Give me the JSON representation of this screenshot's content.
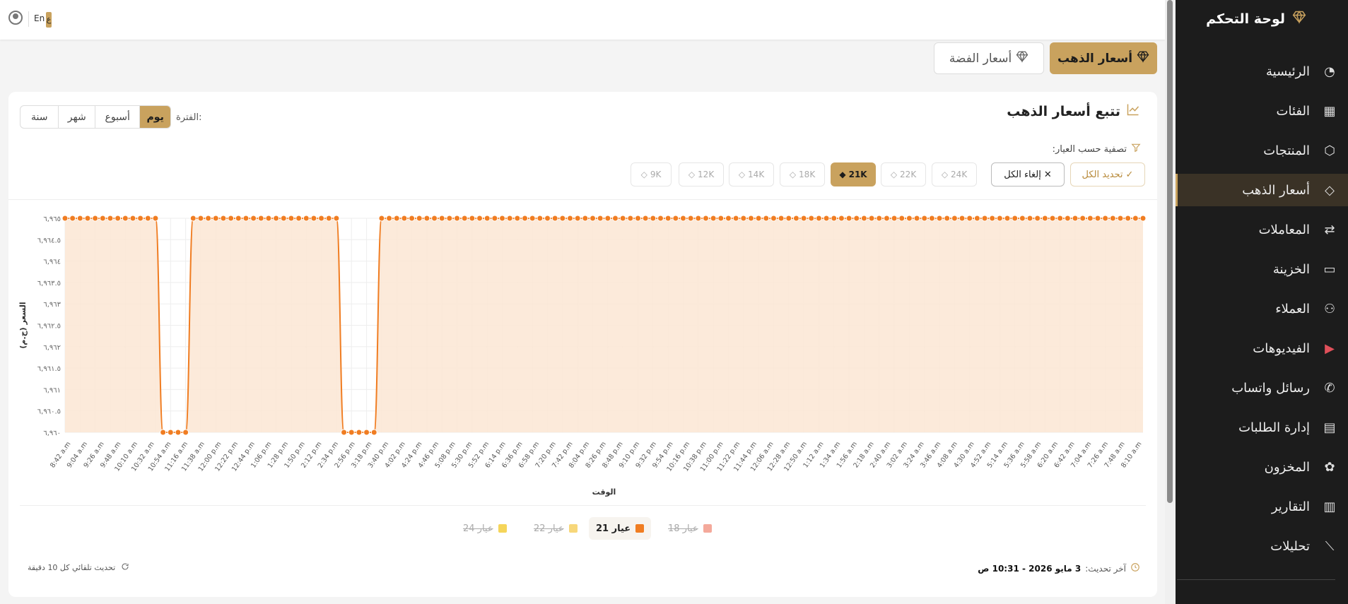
{
  "topbar": {
    "lang_en": "En",
    "lang_ar": "ع"
  },
  "sidebar": {
    "title": "لوحة التحكم",
    "items": [
      {
        "label": "الرئيسية",
        "icon": "gauge-icon"
      },
      {
        "label": "الفئات",
        "icon": "grid-icon"
      },
      {
        "label": "المنتجات",
        "icon": "box-icon"
      },
      {
        "label": "أسعار الذهب",
        "icon": "gem-icon",
        "active": true
      },
      {
        "label": "المعاملات",
        "icon": "transfer-icon"
      },
      {
        "label": "الخزينة",
        "icon": "folder-icon"
      },
      {
        "label": "العملاء",
        "icon": "users-icon"
      },
      {
        "label": "الفيديوهات",
        "icon": "play-circle-icon"
      },
      {
        "label": "رسائل واتساب",
        "icon": "whatsapp-icon"
      },
      {
        "label": "إدارة الطلبات",
        "icon": "orders-icon"
      },
      {
        "label": "المخزون",
        "icon": "stock-icon"
      },
      {
        "label": "التقارير",
        "icon": "bar-chart-icon"
      },
      {
        "label": "تحليلات",
        "icon": "line-chart-icon"
      }
    ]
  },
  "metal_tabs": {
    "gold": "أسعار الذهب",
    "silver": "أسعار الفضة"
  },
  "card": {
    "title": "تتبع أسعار الذهب",
    "period_label": "الفترة:",
    "periods": [
      "يوم",
      "أسبوع",
      "شهر",
      "سنة"
    ],
    "active_period": "يوم",
    "filter_label": "تصفية حسب العيار:",
    "select_all": "تحديد الكل",
    "clear_all": "إلغاء الكل",
    "karats": [
      "24K",
      "22K",
      "21K",
      "18K",
      "14K",
      "12K",
      "9K"
    ],
    "active_karat": "21K",
    "last_update_label": "آخر تحديث:",
    "last_update_value": "3 مايو 2026 - 10:31 ص",
    "auto_refresh": "تحديث تلقائي كل 10 دقيقة"
  },
  "colors": {
    "accent": "#c9a25e",
    "series_21": "#f07d22",
    "fill_21": "#fbe6d3",
    "sidebar_bg": "#1c1c1c"
  },
  "chart_data": {
    "type": "line",
    "xlabel": "الوقت",
    "ylabel": "السعر (ج.م)",
    "ylim": [
      6960,
      6965
    ],
    "yticks": [
      "٦,٩٦٥",
      "٦,٩٦٤.٥",
      "٦,٩٦٤",
      "٦,٩٦٣.٥",
      "٦,٩٦٣",
      "٦,٩٦٢.٥",
      "٦,٩٦٢",
      "٦,٩٦١.٥",
      "٦,٩٦١",
      "٦,٩٦٠.٥",
      "٦,٩٦٠"
    ],
    "xticks": [
      "8:42 a.m",
      "9:04 a.m",
      "9:26 a.m",
      "9:48 a.m",
      "10:10 a.m",
      "10:32 a.m",
      "10:54 a.m",
      "11:16 a.m",
      "11:38 a.m",
      "12:00 p.m",
      "12:22 p.m",
      "12:44 p.m",
      "1:06 p.m",
      "1:28 p.m",
      "1:50 p.m",
      "2:12 p.m",
      "2:34 p.m",
      "2:56 p.m",
      "3:18 p.m",
      "3:40 p.m",
      "4:02 p.m",
      "4:24 p.m",
      "4:46 p.m",
      "5:08 p.m",
      "5:30 p.m",
      "5:52 p.m",
      "6:14 p.m",
      "6:36 p.m",
      "6:58 p.m",
      "7:20 p.m",
      "7:42 p.m",
      "8:04 p.m",
      "8:26 p.m",
      "8:48 p.m",
      "9:10 p.m",
      "9:32 p.m",
      "9:54 p.m",
      "10:16 p.m",
      "10:38 p.m",
      "11:00 p.m",
      "11:22 p.m",
      "11:44 p.m",
      "12:06 a.m",
      "12:28 a.m",
      "12:50 a.m",
      "1:12 a.m",
      "1:34 a.m",
      "1:56 a.m",
      "2:18 a.m",
      "2:40 a.m",
      "3:02 a.m",
      "3:24 a.m",
      "3:46 a.m",
      "4:08 a.m",
      "4:30 a.m",
      "4:52 a.m",
      "5:14 a.m",
      "5:36 a.m",
      "5:58 a.m",
      "6:20 a.m",
      "6:42 a.m",
      "7:04 a.m",
      "7:26 a.m",
      "7:48 a.m",
      "8:10 a.m"
    ],
    "series": [
      {
        "name": "عيار 21",
        "color": "#f07d22",
        "visible": true,
        "low_ranges": [
          [
            13,
            16
          ],
          [
            37,
            41
          ]
        ],
        "high": 6965,
        "low": 6960,
        "count": 144
      }
    ],
    "legend": [
      {
        "label": "عيار 18",
        "color": "#f4a99b",
        "visible": false
      },
      {
        "label": "عيار 21",
        "color": "#f07d22",
        "visible": true
      },
      {
        "label": "عيار 22",
        "color": "#f7d77a",
        "visible": false
      },
      {
        "label": "عيار 24",
        "color": "#f5d55a",
        "visible": false
      }
    ]
  }
}
